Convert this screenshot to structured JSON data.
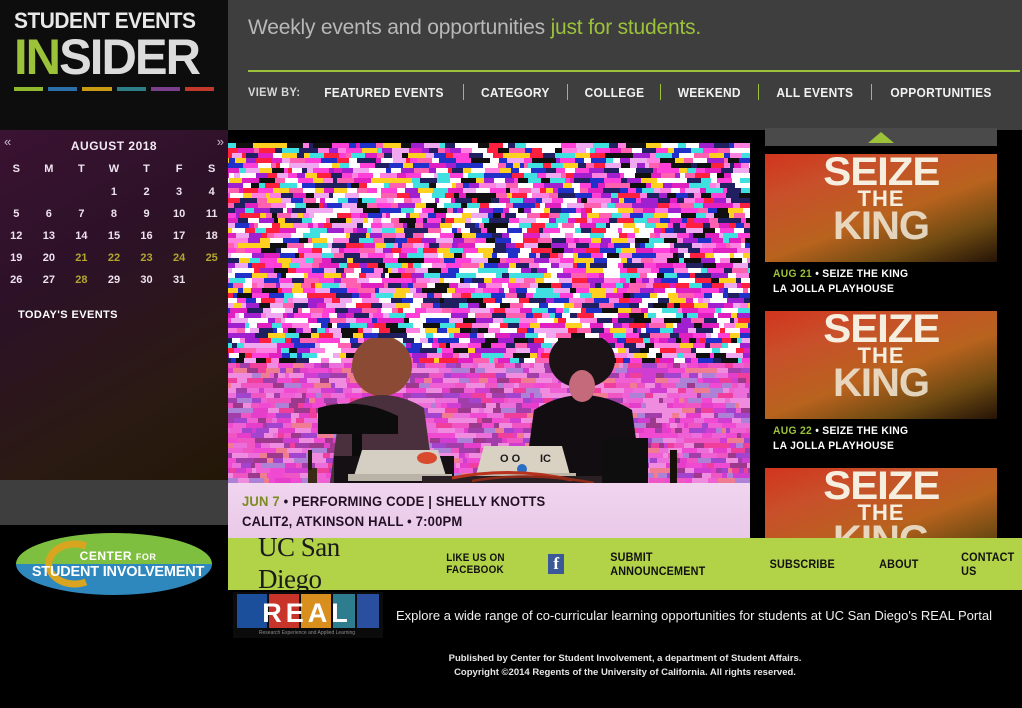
{
  "brand": {
    "line1": "STUDENT EVENTS",
    "in": "IN",
    "sider": "SIDER",
    "bar_colors": [
      "#8fb82e",
      "#2d6fa8",
      "#c99a14",
      "#2c7f86",
      "#7a3f8c",
      "#c0392b"
    ]
  },
  "header": {
    "tagline_plain": "Weekly events and opportunities ",
    "tagline_accent": "just for students.",
    "accent_color": "#9cc23a"
  },
  "nav": {
    "view_by_label": "VIEW BY:",
    "items": [
      {
        "label": "FEATURED EVENTS"
      },
      {
        "label": "CATEGORY"
      },
      {
        "label": "COLLEGE"
      },
      {
        "label": "WEEKEND"
      },
      {
        "label": "ALL EVENTS"
      },
      {
        "label": "OPPORTUNITIES"
      }
    ]
  },
  "calendar": {
    "prev_icon": "«",
    "next_icon": "»",
    "title": "AUGUST 2018",
    "weekdays": [
      "S",
      "M",
      "T",
      "W",
      "T",
      "F",
      "S"
    ],
    "weeks": [
      [
        {
          "d": "",
          "hl": false,
          "empty": true
        },
        {
          "d": "",
          "hl": false,
          "empty": true
        },
        {
          "d": "",
          "hl": false,
          "empty": true
        },
        {
          "d": "1",
          "hl": false
        },
        {
          "d": "2",
          "hl": false
        },
        {
          "d": "3",
          "hl": false
        },
        {
          "d": "4",
          "hl": false
        }
      ],
      [
        {
          "d": "5",
          "hl": false
        },
        {
          "d": "6",
          "hl": false
        },
        {
          "d": "7",
          "hl": false
        },
        {
          "d": "8",
          "hl": false
        },
        {
          "d": "9",
          "hl": false
        },
        {
          "d": "10",
          "hl": false
        },
        {
          "d": "11",
          "hl": false
        }
      ],
      [
        {
          "d": "12",
          "hl": false
        },
        {
          "d": "13",
          "hl": false
        },
        {
          "d": "14",
          "hl": false
        },
        {
          "d": "15",
          "hl": false
        },
        {
          "d": "16",
          "hl": false
        },
        {
          "d": "17",
          "hl": false
        },
        {
          "d": "18",
          "hl": false
        }
      ],
      [
        {
          "d": "19",
          "hl": false
        },
        {
          "d": "20",
          "hl": false
        },
        {
          "d": "21",
          "hl": true
        },
        {
          "d": "22",
          "hl": true
        },
        {
          "d": "23",
          "hl": true
        },
        {
          "d": "24",
          "hl": true
        },
        {
          "d": "25",
          "hl": true
        }
      ],
      [
        {
          "d": "26",
          "hl": false
        },
        {
          "d": "27",
          "hl": false
        },
        {
          "d": "28",
          "hl": true
        },
        {
          "d": "29",
          "hl": false
        },
        {
          "d": "30",
          "hl": false
        },
        {
          "d": "31",
          "hl": false
        },
        {
          "d": "",
          "hl": false,
          "empty": true
        }
      ]
    ],
    "highlight_color": "#b3a630",
    "todays_events_label": "TODAY'S EVENTS"
  },
  "feature": {
    "caption_date": "JUN 7",
    "caption_sep": " • ",
    "caption_title": "PERFORMING CODE  |  SHELLY KNOTTS",
    "caption_venue": "CALIT2, ATKINSON HALL • 7:00PM"
  },
  "rail": {
    "scroll_up_icon": "up-arrow",
    "cards": [
      {
        "poster_l1": "SEIZE",
        "poster_l2": "THE",
        "poster_l3": "KING",
        "date": "AUG 21",
        "sep": " • ",
        "title": "SEIZE THE KING",
        "venue": "LA JOLLA PLAYHOUSE"
      },
      {
        "poster_l1": "SEIZE",
        "poster_l2": "THE",
        "poster_l3": "KING",
        "date": "AUG 22",
        "sep": " • ",
        "title": "SEIZE THE KING",
        "venue": "LA JOLLA PLAYHOUSE"
      },
      {
        "poster_l1": "SEIZE",
        "poster_l2": "THE",
        "poster_l3": "KING",
        "date": "",
        "sep": "",
        "title": "",
        "venue": ""
      }
    ]
  },
  "csi_logo": {
    "line1": "CENTER",
    "for": "FOR",
    "line2": "STUDENT INVOLVEMENT",
    "green": "#7fbf3f",
    "blue": "#2e87bd",
    "gold": "#d9a521"
  },
  "footer": {
    "ucsd_logo_text": "UC San Diego",
    "facebook_label": "LIKE US ON FACEBOOK",
    "facebook_icon": "f",
    "links": [
      {
        "label": "SUBMIT ANNOUNCEMENT"
      },
      {
        "label": "SUBSCRIBE"
      },
      {
        "label": "ABOUT"
      },
      {
        "label": "CONTACT US"
      }
    ],
    "bar_color": "#b2d247"
  },
  "real_banner": {
    "logo_text": "REAL",
    "logo_subtitle": "Research Experience and Applied Learning",
    "message": "Explore a wide range of co-curricular learning opportunities for students at UC San Diego's REAL Portal"
  },
  "copyright": {
    "line1": "Published by Center for Student Involvement, a department of Student Affairs.",
    "line2": "Copyright ©2014 Regents of the University of California. All rights reserved."
  }
}
